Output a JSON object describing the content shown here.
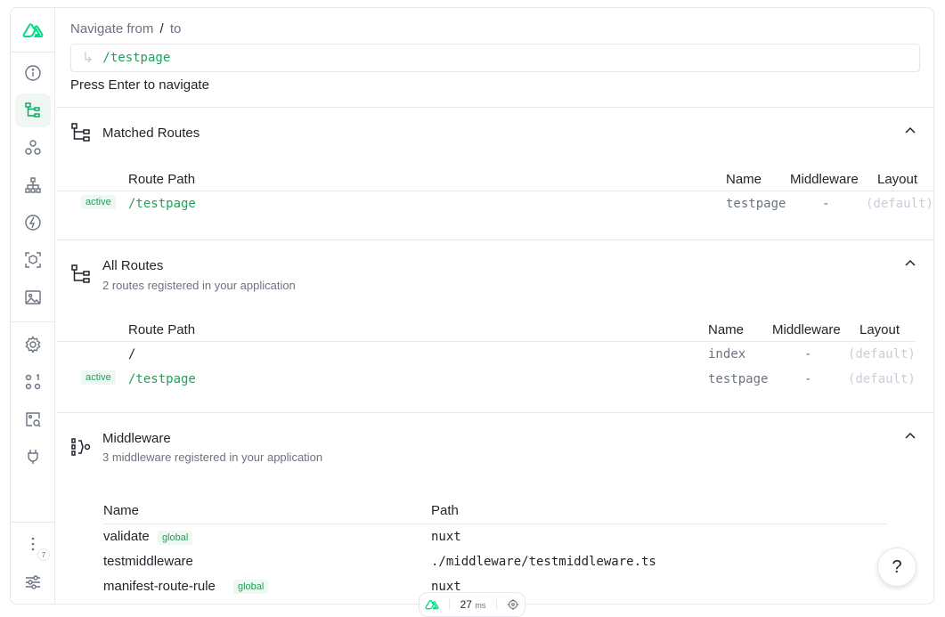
{
  "navigate": {
    "title_prefix": "Navigate from",
    "title_slash": "/",
    "title_suffix": "to",
    "arrow_icon": "↳",
    "input_value": "/testpage",
    "hint_prefix": "Press",
    "hint_key": "Enter",
    "hint_suffix": "to navigate"
  },
  "matched": {
    "title": "Matched Routes",
    "headers": {
      "path": "Route Path",
      "name": "Name",
      "middleware": "Middleware",
      "layout": "Layout"
    },
    "rows": [
      {
        "tag": "active",
        "path": "/testpage",
        "name": "testpage",
        "middleware": "-",
        "layout": "(default)"
      }
    ]
  },
  "all_routes": {
    "title": "All Routes",
    "subtitle": "2 routes registered in your application",
    "headers": {
      "path": "Route Path",
      "name": "Name",
      "middleware": "Middleware",
      "layout": "Layout"
    },
    "rows": [
      {
        "tag": "",
        "path": "/",
        "name": "index",
        "middleware": "-",
        "layout": "(default)"
      },
      {
        "tag": "active",
        "path": "/testpage",
        "name": "testpage",
        "middleware": "-",
        "layout": "(default)"
      }
    ]
  },
  "middleware": {
    "title": "Middleware",
    "subtitle": "3 middleware registered in your application",
    "headers": {
      "name": "Name",
      "path": "Path"
    },
    "rows": [
      {
        "name": "validate",
        "tag": "global",
        "path": "nuxt"
      },
      {
        "name": "testmiddleware",
        "tag": "",
        "path": "./middleware/testmiddleware.ts"
      },
      {
        "name": "manifest-route-rule",
        "tag": "global",
        "path": "nuxt"
      }
    ]
  },
  "sidebar": {
    "badge": "7"
  },
  "help": {
    "label": "?"
  },
  "status": {
    "time_value": "27",
    "time_unit": "ms"
  },
  "colors": {
    "accent": "#00dc82",
    "text_green": "#22a05a"
  }
}
